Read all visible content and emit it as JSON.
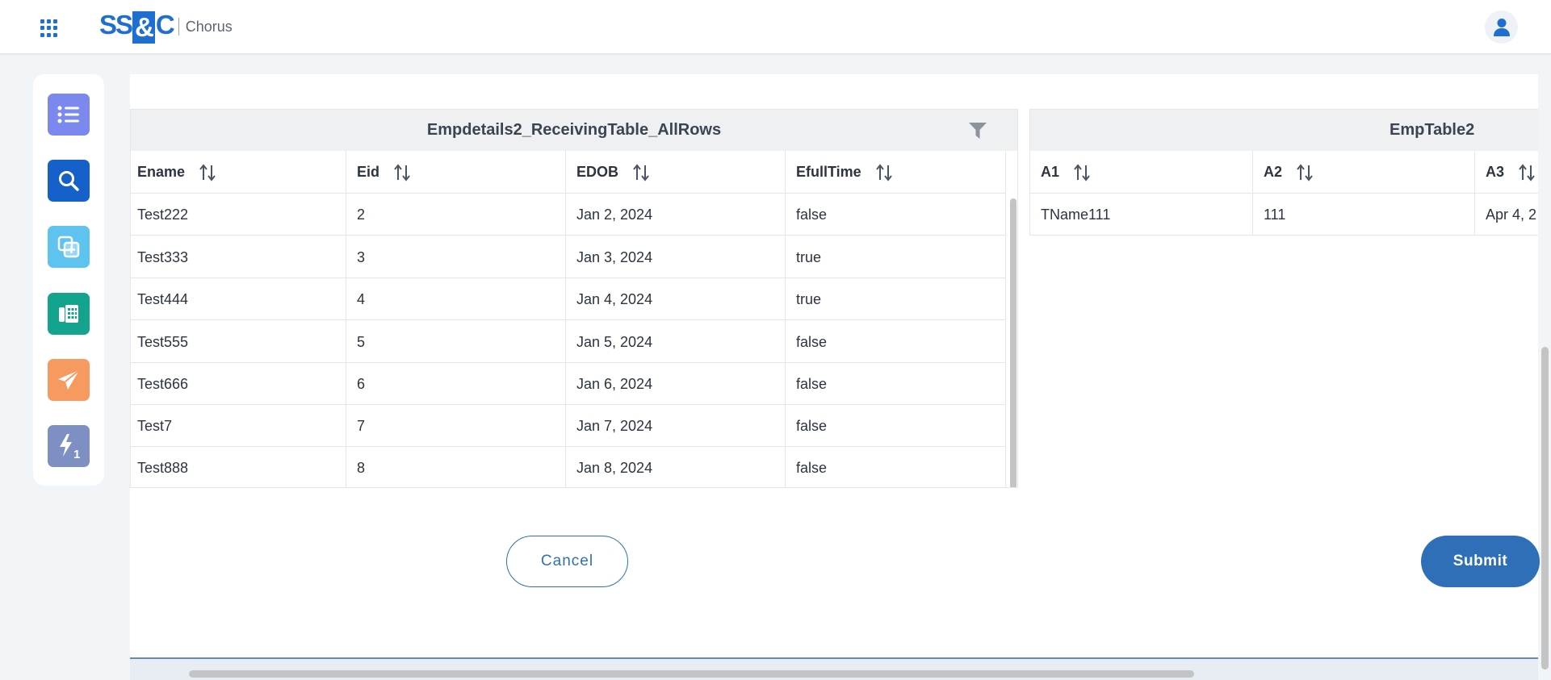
{
  "header": {
    "logo_mark_left": "SS",
    "logo_mark_amp": "&",
    "logo_mark_right": "C",
    "product_name": "Chorus"
  },
  "sidebar": {
    "items": [
      {
        "icon": "list-icon",
        "color": "#7b88ee"
      },
      {
        "icon": "search-icon",
        "color": "#1560c9"
      },
      {
        "icon": "add-copy-icon",
        "color": "#5ec3ee"
      },
      {
        "icon": "calculator-document-icon",
        "color": "#14a38d"
      },
      {
        "icon": "send-icon",
        "color": "#f79a60"
      },
      {
        "icon": "flash-one-icon",
        "color": "#7d8fc3"
      }
    ]
  },
  "left_table": {
    "title": "Empdetails2_ReceivingTable_AllRows",
    "columns": [
      "Ename",
      "Eid",
      "EDOB",
      "EfullTime"
    ],
    "rows": [
      [
        "Test222",
        "2",
        "Jan 2, 2024",
        "false"
      ],
      [
        "Test333",
        "3",
        "Jan 3, 2024",
        "true"
      ],
      [
        "Test444",
        "4",
        "Jan 4, 2024",
        "true"
      ],
      [
        "Test555",
        "5",
        "Jan 5, 2024",
        "false"
      ],
      [
        "Test666",
        "6",
        "Jan 6, 2024",
        "false"
      ],
      [
        "Test7",
        "7",
        "Jan 7, 2024",
        "false"
      ],
      [
        "Test888",
        "8",
        "Jan 8, 2024",
        "false"
      ]
    ]
  },
  "right_table": {
    "title": "EmpTable2",
    "columns": [
      "A1",
      "A2",
      "A3"
    ],
    "rows": [
      [
        "TName111",
        "111",
        "Apr 4, 2"
      ]
    ]
  },
  "actions": {
    "cancel_label": "Cancel",
    "submit_label": "Submit"
  },
  "colors": {
    "accent": "#2f6fb7",
    "brand": "#1f6fd1"
  }
}
